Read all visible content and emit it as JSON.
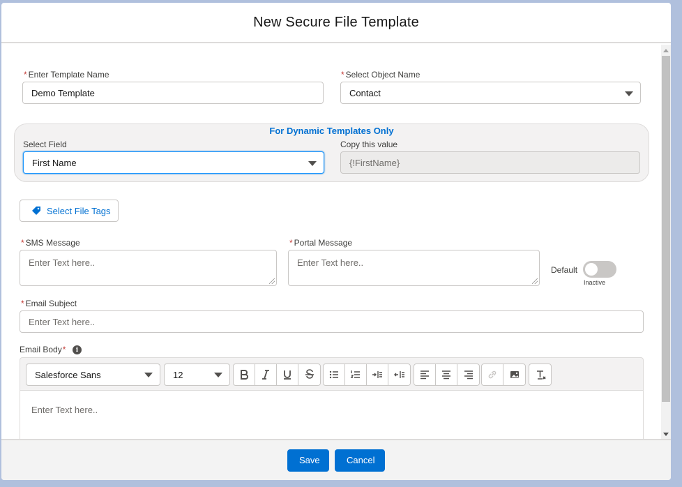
{
  "modal": {
    "title": "New Secure File Template"
  },
  "template_name": {
    "label": "Enter Template Name",
    "value": "Demo Template"
  },
  "object_name": {
    "label": "Select Object Name",
    "value": "Contact"
  },
  "dynamic": {
    "title": "For Dynamic Templates Only",
    "select_field_label": "Select Field",
    "select_field_value": "First Name",
    "copy_label": "Copy this value",
    "copy_value": "{!FirstName}"
  },
  "tags_button": {
    "label": "Select File Tags",
    "icon": "tag-icon"
  },
  "sms": {
    "label": "SMS Message",
    "placeholder": "Enter Text here.."
  },
  "portal": {
    "label": "Portal Message",
    "placeholder": "Enter Text here.."
  },
  "default_toggle": {
    "label": "Default",
    "state_text": "Inactive",
    "on": false
  },
  "email_subject": {
    "label": "Email Subject",
    "placeholder": "Enter Text here.."
  },
  "email_body": {
    "label": "Email Body",
    "info_icon": "info-icon",
    "font_family": "Salesforce Sans",
    "font_size": "12",
    "placeholder": "Enter Text here.."
  },
  "footer": {
    "save_label": "Save",
    "cancel_label": "Cancel"
  },
  "colors": {
    "brand": "#0070d2",
    "required": "#c23934",
    "backdrop": "#b0c0dd"
  }
}
